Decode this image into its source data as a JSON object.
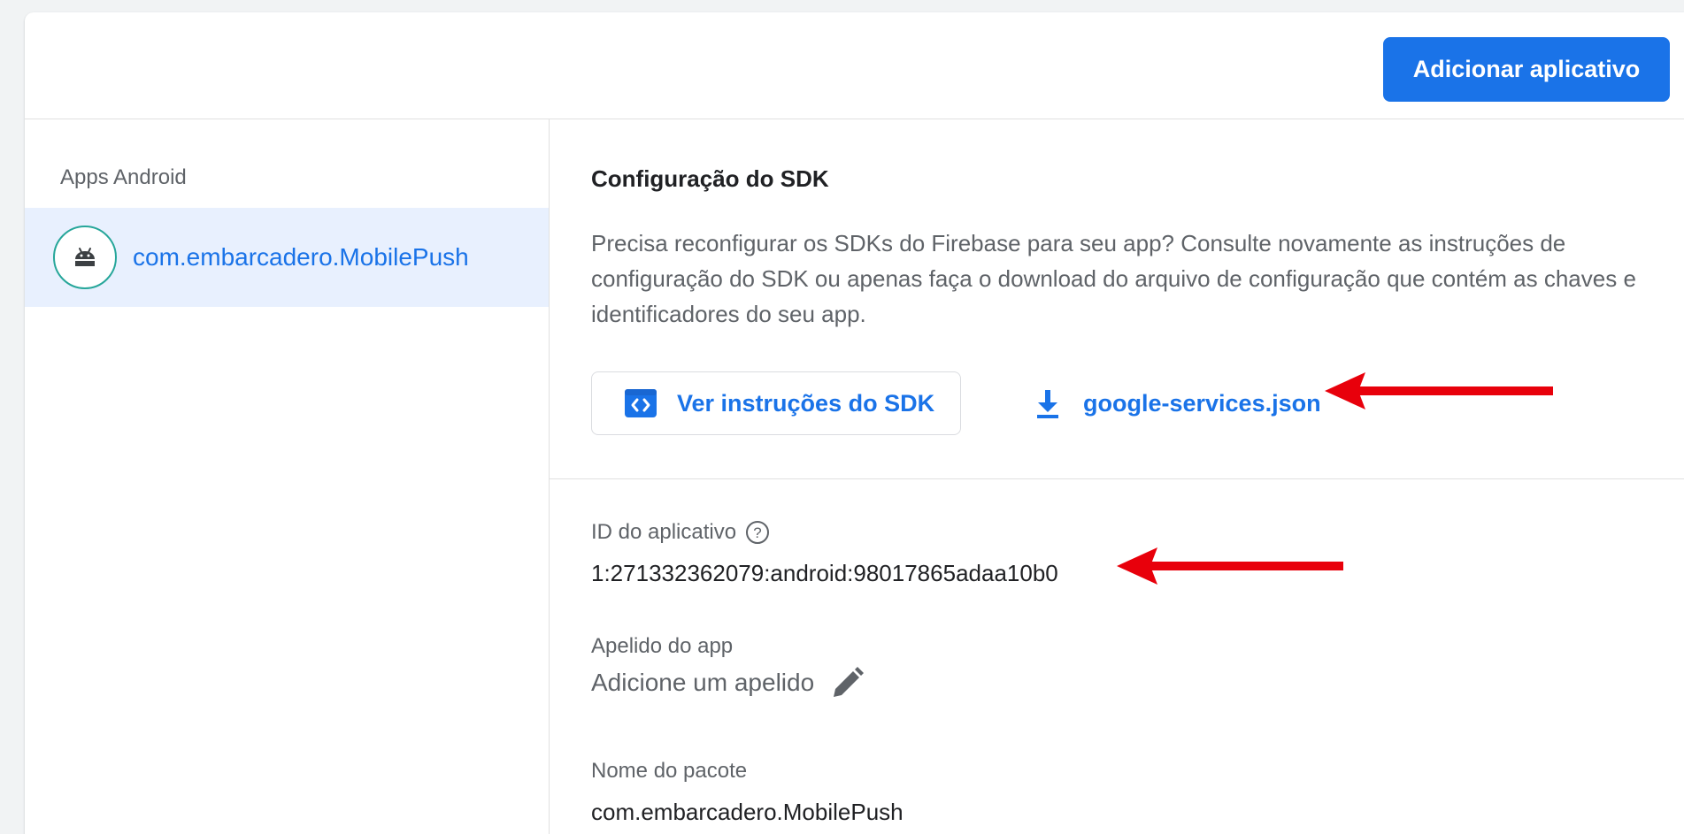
{
  "toolbar": {
    "add_app_label": "Adicionar aplicativo"
  },
  "sidebar": {
    "title": "Apps Android",
    "items": [
      {
        "label": "com.embarcadero.MobilePush",
        "icon": "android-icon"
      }
    ]
  },
  "sdk_section": {
    "title": "Configuração do SDK",
    "description": "Precisa reconfigurar os SDKs do Firebase para seu app? Consulte novamente as instruções de configuração do SDK ou apenas faça o download do arquivo de configuração que contém as chaves e identificadores do seu app.",
    "instructions_button": "Ver instruções do SDK",
    "download_label": "google-services.json"
  },
  "details": {
    "app_id_label": "ID do aplicativo",
    "app_id_value": "1:271332362079:android:98017865adaa10b0",
    "nickname_label": "Apelido do app",
    "nickname_placeholder": "Adicione um apelido",
    "package_label": "Nome do pacote",
    "package_value": "com.embarcadero.MobilePush"
  },
  "colors": {
    "accent": "#1a73e8",
    "selected_bg": "#e8f0fe",
    "avatar_border": "#26a69a",
    "annotation_arrow": "#e8000b"
  }
}
